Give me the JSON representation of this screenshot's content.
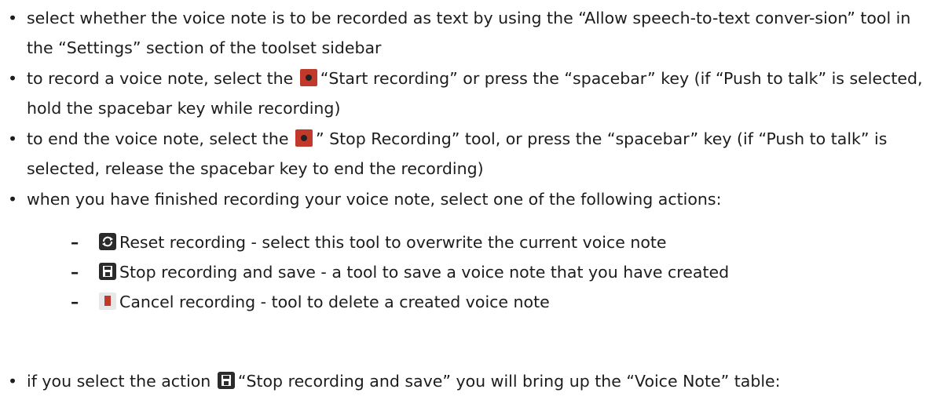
{
  "bullets": [
    {
      "text_1": "select whether the voice note is to be recorded as text by using the “Allow speech-to-text conver-sion” tool in the “Settings” section of the toolset sidebar"
    },
    {
      "before": "to record a voice note, select the",
      "after": "“Start recording” or press the “spacebar” key (if “Push to talk” is selected, hold the spacebar key while recording)",
      "icon": "record-icon"
    },
    {
      "before": "to end the voice note, select the",
      "after": "” Stop Recording” tool, or press the “spacebar” key (if “Push to talk” is selected, release the spacebar key to end the recording)",
      "icon": "stop-record-icon"
    },
    {
      "text_1": "when you have finished recording your voice note, select one of the following actions:"
    }
  ],
  "sub_items": [
    {
      "dash": "–",
      "icon": "reset-icon",
      "text": "Reset recording - select this tool to overwrite the current voice note"
    },
    {
      "dash": "–",
      "icon": "save-icon",
      "text": "Stop recording and save - a tool to save a voice note that you have created"
    },
    {
      "dash": "–",
      "icon": "trash-icon",
      "text": "Cancel recording - tool to delete a created voice note"
    }
  ],
  "final_bullet": {
    "before": "if you select the action",
    "after": "“Stop recording and save” you will bring up the “Voice Note” table:",
    "icon": "save-icon"
  },
  "bullet_char": "•",
  "colors": {
    "record": "#c0392b",
    "icon_dark": "#2b2b2b",
    "text": "#1c1c1c"
  }
}
